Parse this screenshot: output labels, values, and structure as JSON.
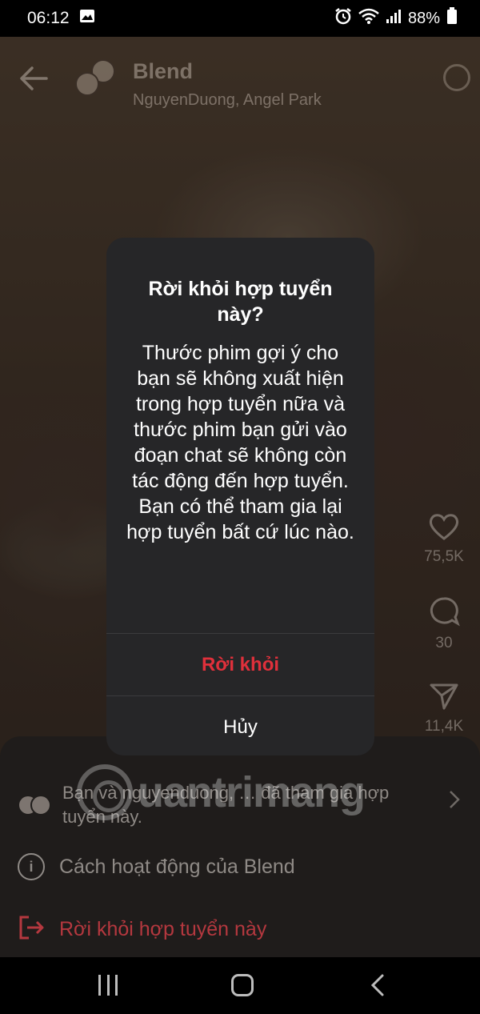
{
  "status_bar": {
    "time": "06:12",
    "battery": "88%",
    "icons": [
      "image-icon",
      "alarm-icon",
      "wifi-icon",
      "signal-icon",
      "battery-icon"
    ]
  },
  "header": {
    "title": "Blend",
    "subtitle": "NguyenDuong, Angel Park"
  },
  "side_actions": {
    "likes": "75,5K",
    "comments": "30",
    "shares": "11,4K"
  },
  "dialog": {
    "title": "Rời khỏi hợp tuyển này?",
    "body": "Thước phim gợi ý cho bạn sẽ không xuất hiện trong hợp tuyển nữa và thước phim bạn gửi vào đoạn chat sẽ không còn tác động đến hợp tuyển. Bạn có thể tham gia lại hợp tuyển bất cứ lúc nào.",
    "leave_label": "Rời khỏi",
    "cancel_label": "Hủy"
  },
  "sheet": {
    "members_text": "Bạn và nguyenduong, … đã tham gia hợp tuyển này.",
    "how_it_works": "Cách hoạt động của Blend",
    "leave_blend": "Rời khỏi hợp tuyển này"
  },
  "watermark": "uantrimang",
  "colors": {
    "dialog_bg": "#262628",
    "danger": "#e0303b",
    "sheet_bg": "#1f1c1b"
  }
}
